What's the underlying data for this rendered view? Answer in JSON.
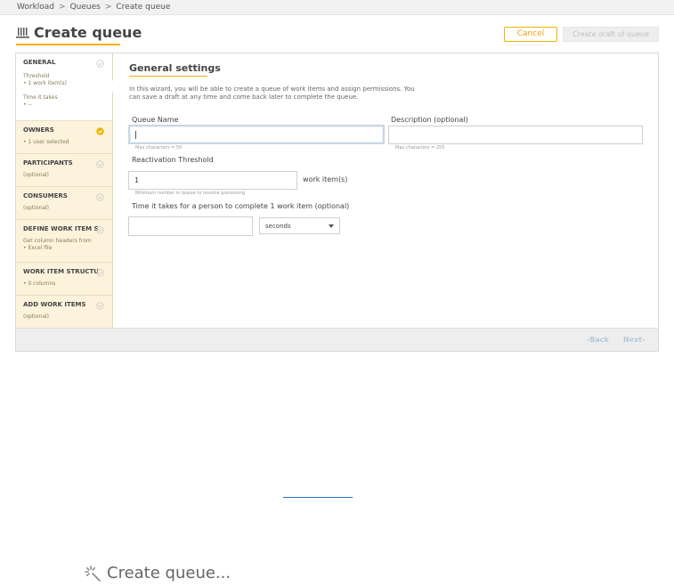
{
  "breadcrumb": {
    "items": [
      "Workload",
      "Queues",
      "Create queue"
    ],
    "separator": ">"
  },
  "page": {
    "title": "Create queue",
    "accent_color": "#f0b400"
  },
  "actions": {
    "cancel_label": "Cancel",
    "draft_label": "Create draft of queue"
  },
  "sidebar": {
    "steps": [
      {
        "title": "GENERAL",
        "sub1": "Threshold",
        "sub2": "• 1 work item(s)",
        "sub3": "Time it takes",
        "sub4": "• --",
        "state": "done",
        "active": true
      },
      {
        "title": "OWNERS",
        "sub1": "• 1 user selected",
        "state": "complete"
      },
      {
        "title": "PARTICIPANTS",
        "sub1": "(optional)",
        "state": "done"
      },
      {
        "title": "CONSUMERS",
        "sub1": "(optional)",
        "state": "done"
      },
      {
        "title": "DEFINE WORK ITEM STR...",
        "sub1": "Get column headers from",
        "sub2": "• Excel file",
        "state": "done"
      },
      {
        "title": "WORK ITEM STRUCTURE",
        "sub1": "• 0 columns",
        "state": "done"
      },
      {
        "title": "ADD WORK ITEMS",
        "sub1": "(optional)",
        "state": "done"
      }
    ]
  },
  "form": {
    "section_title": "General settings",
    "intro": "In this wizard, you will be able to create a queue of work items and assign permissions. You can save a draft at any time and come back later to complete the queue.",
    "queue_name": {
      "label": "Queue Name",
      "value": "",
      "hint": "Max characters = 50"
    },
    "description": {
      "label": "Description (optional)",
      "value": "",
      "hint": "Max characters = 255"
    },
    "threshold": {
      "label": "Reactivation Threshold",
      "value": "1",
      "unit": "work item(s)",
      "hint": "Minimum number in queue to resume processing"
    },
    "time": {
      "label": "Time it takes for a person to complete 1 work item (optional)",
      "value": "",
      "unit_selected": "seconds"
    }
  },
  "nav": {
    "back_label": "Back",
    "next_label": "Next"
  },
  "loading": {
    "text": "Create queue..."
  }
}
